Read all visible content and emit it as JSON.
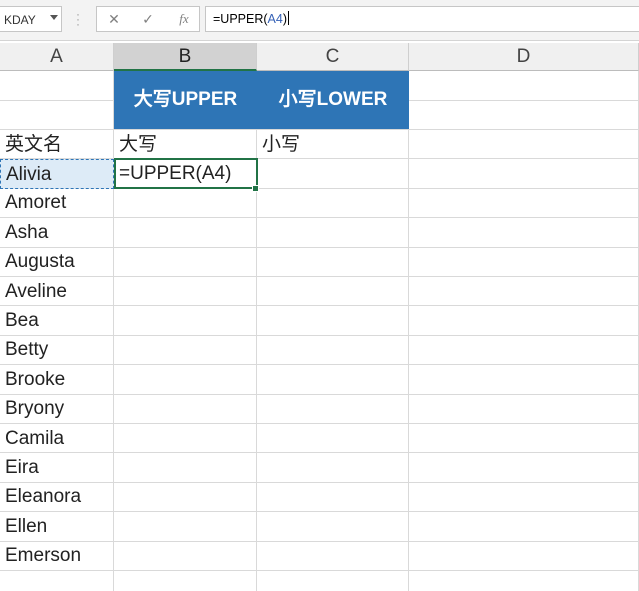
{
  "formula_bar": {
    "name_box": "KDAY",
    "cancel_icon": "✕",
    "enter_icon": "✓",
    "fx_label": "fx",
    "formula_prefix": "=UPPER(",
    "formula_ref": "A4",
    "formula_suffix": ")"
  },
  "columns": [
    "A",
    "B",
    "C",
    "D"
  ],
  "header_row": {
    "b": "大写UPPER",
    "c": "小写LOWER"
  },
  "row3": {
    "a": "英文名",
    "b": "大写",
    "c": "小写"
  },
  "active_cell_text": "=UPPER(A4)",
  "names": [
    "Alivia",
    "Amoret",
    "Asha",
    "Augusta",
    "Aveline",
    "Bea",
    "Betty",
    "Brooke",
    "Bryony",
    "Camila",
    "Eira",
    "Eleanora",
    "Ellen",
    "Emerson"
  ],
  "colors": {
    "header_fill": "#2e75b6",
    "header_text": "#ffffff",
    "selection_border": "#217346",
    "copy_source_fill": "#ddebf7"
  }
}
